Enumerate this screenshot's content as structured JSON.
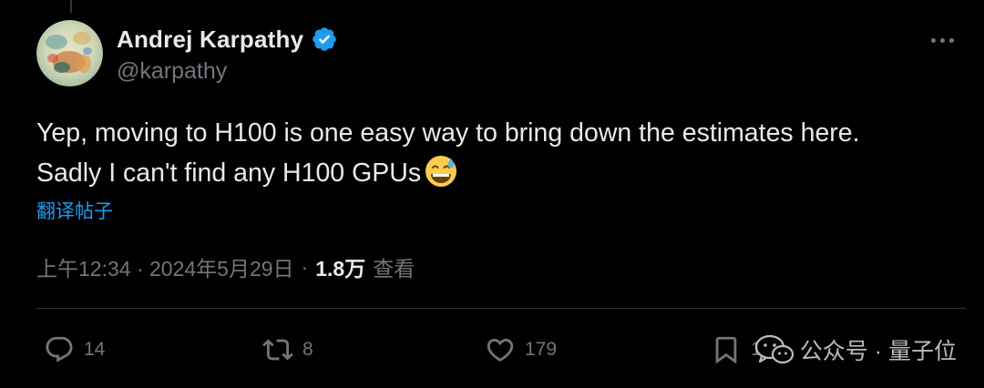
{
  "author": {
    "display_name": "Andrej Karpathy",
    "handle": "@karpathy",
    "verified_color": "#1d9bf0"
  },
  "tweet": {
    "line1": "Yep, moving to H100 is one easy way to bring down the estimates here.",
    "line2": "Sadly I can't find any H100 GPUs",
    "emoji": "grinning-face-with-sweat-icon",
    "translate_label": "翻译帖子"
  },
  "meta": {
    "timestamp": "上午12:34 · 2024年5月29日",
    "separator": "·",
    "views_count": "1.8万",
    "views_label": "查看"
  },
  "actions": {
    "replies": "14",
    "reposts": "8",
    "likes": "179",
    "bookmarks": "1"
  },
  "watermark": {
    "text": "公众号 · 量子位"
  },
  "colors": {
    "background": "#000000",
    "text": "#e7e9ea",
    "muted": "#71767b",
    "accent": "#1d9bf0",
    "divider": "#2f3336"
  }
}
